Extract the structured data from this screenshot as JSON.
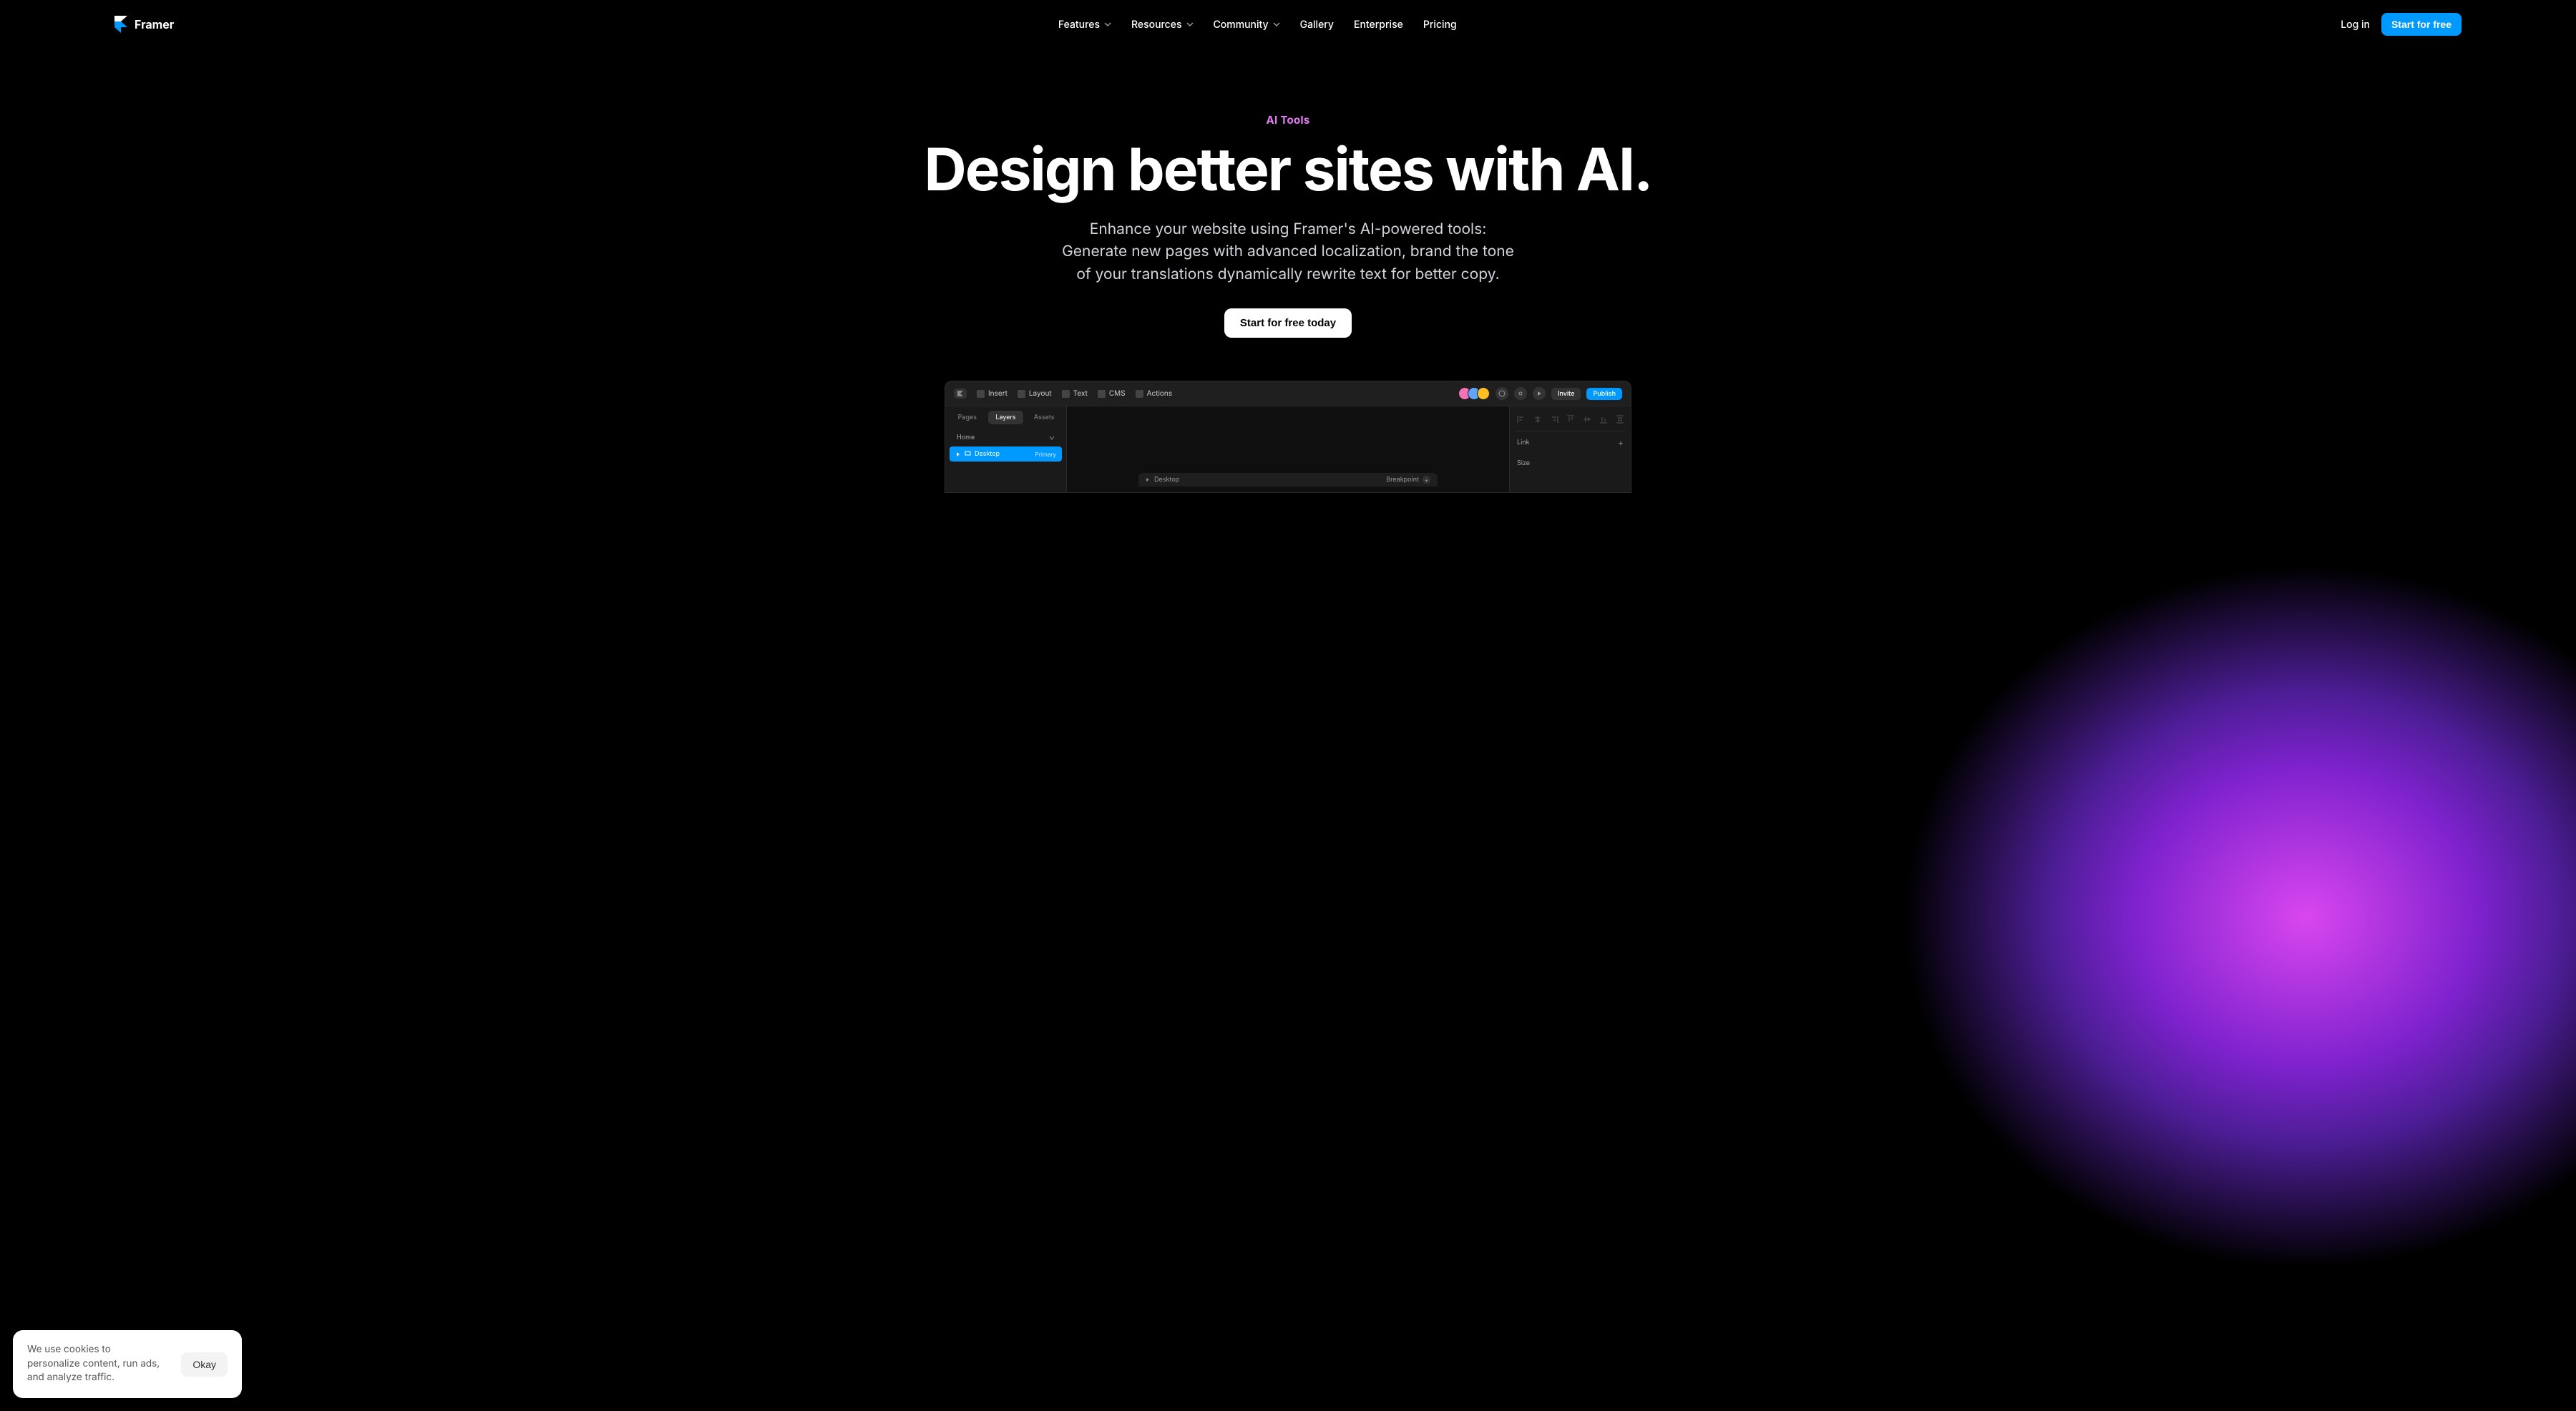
{
  "brand": "Framer",
  "nav": {
    "items": [
      {
        "label": "Features",
        "dropdown": true
      },
      {
        "label": "Resources",
        "dropdown": true
      },
      {
        "label": "Community",
        "dropdown": true
      },
      {
        "label": "Gallery",
        "dropdown": false
      },
      {
        "label": "Enterprise",
        "dropdown": false
      },
      {
        "label": "Pricing",
        "dropdown": false
      }
    ],
    "login": "Log in",
    "cta": "Start for free"
  },
  "hero": {
    "eyebrow": "AI Tools",
    "headline": "Design better sites with AI.",
    "sub": "Enhance your website using Framer's AI-powered tools: Generate new pages with advanced localization, brand the tone of your translations dynamically rewrite text for better copy.",
    "cta": "Start for free today"
  },
  "app": {
    "toolbar": {
      "items": [
        "Insert",
        "Layout",
        "Text",
        "CMS",
        "Actions"
      ],
      "invite": "Invite",
      "publish": "Publish"
    },
    "sidebar": {
      "tabs": [
        "Pages",
        "Layers",
        "Assets"
      ],
      "active_tab": "Layers",
      "home": "Home",
      "desktop": "Desktop",
      "primary": "Primary"
    },
    "canvas": {
      "label": "Desktop",
      "breakpoint": "Breakpoint"
    },
    "rightpanel": {
      "link": "Link",
      "size": "Size"
    }
  },
  "cookie": {
    "text": "We use cookies to personalize content, run ads, and analyze traffic.",
    "button": "Okay"
  }
}
